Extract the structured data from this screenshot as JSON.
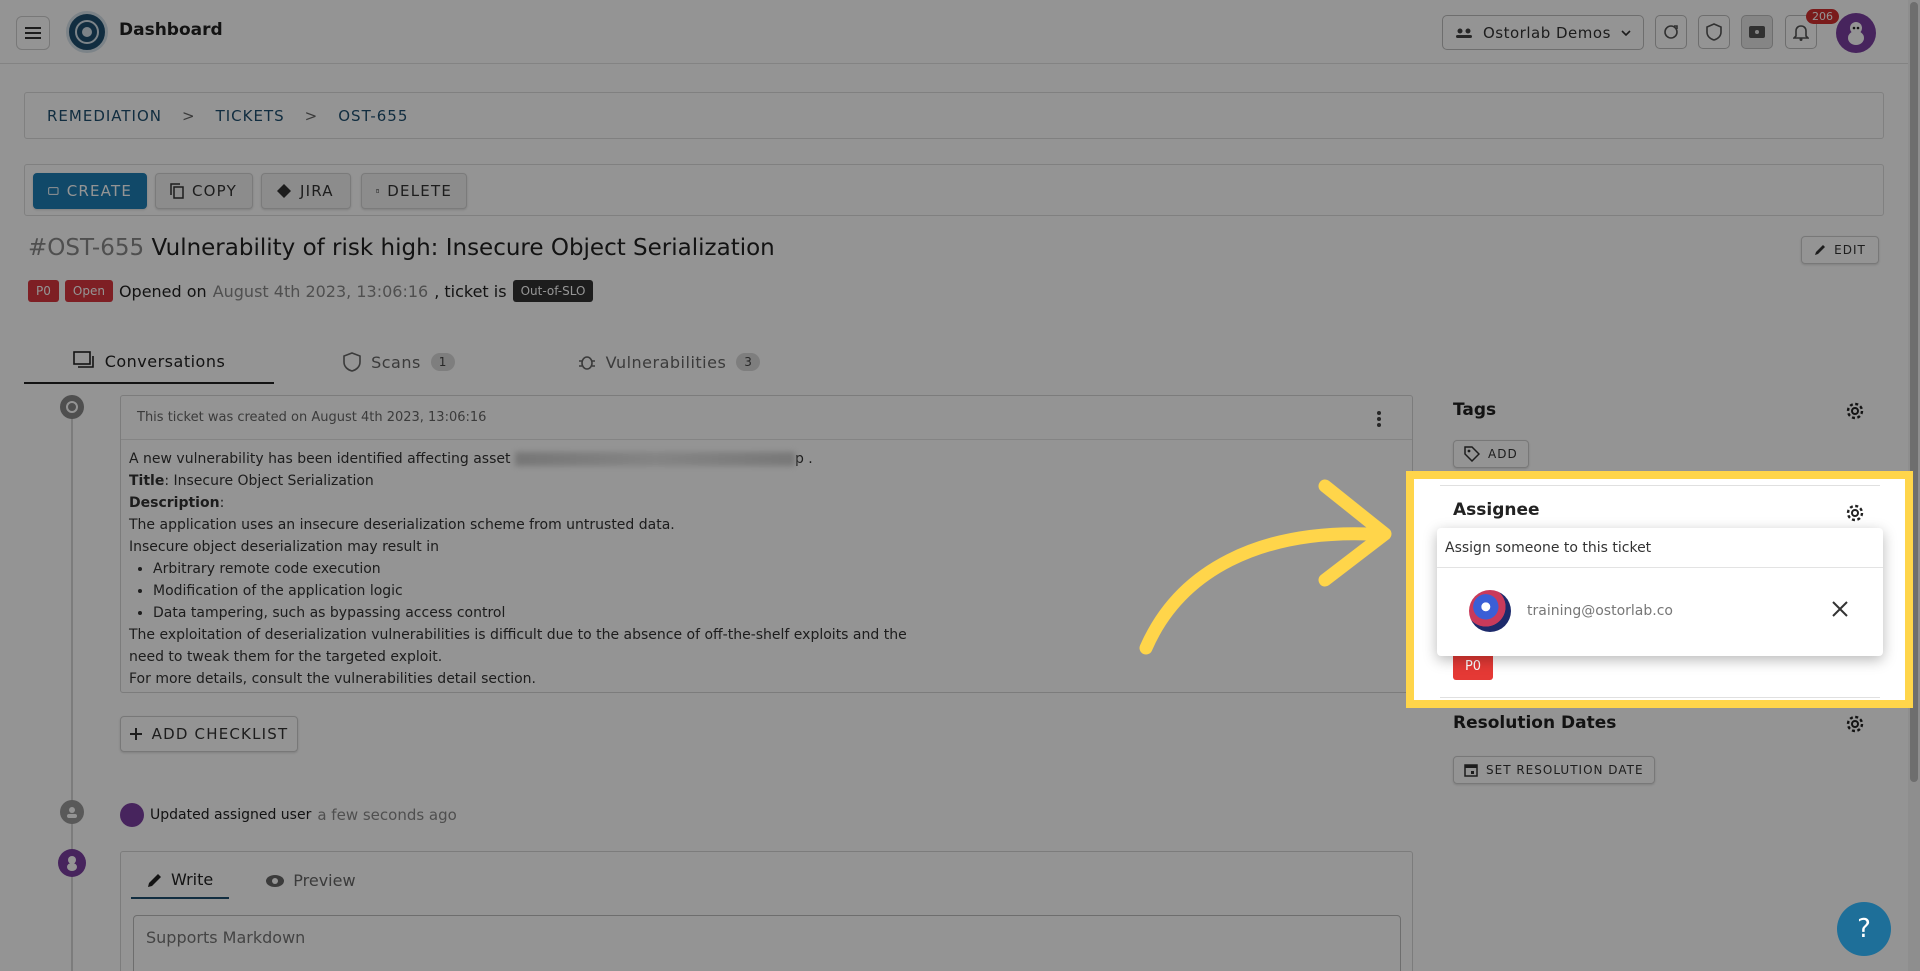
{
  "header": {
    "title": "Dashboard",
    "org": "Ostorlab Demos",
    "notification_count": "206"
  },
  "breadcrumb": [
    "REMEDIATION",
    "TICKETS",
    "OST-655"
  ],
  "breadcrumb_sep": ">",
  "actions": {
    "create": "CREATE",
    "copy": "COPY",
    "jira": "JIRA",
    "delete": "DELETE",
    "edit": "EDIT"
  },
  "ticket": {
    "id": "#OST-655",
    "title": "Vulnerability of risk high: Insecure Object Serialization",
    "priority": "P0",
    "status": "Open",
    "opened_label": "Opened on",
    "opened_at": "August 4th 2023, 13:06:16",
    "ticket_is": ", ticket is",
    "slo": "Out-of-SLO"
  },
  "tabs": {
    "conversations": "Conversations",
    "scans": "Scans",
    "scans_count": "1",
    "vulnerabilities": "Vulnerabilities",
    "vulnerabilities_count": "3"
  },
  "conversation": {
    "created_note": "This ticket was created on August 4th 2023, 13:06:16",
    "intro": "A new vulnerability has been identified affecting asset",
    "intro_suffix": "p .",
    "title_label": "Title",
    "title_value": ": Insecure Object Serialization",
    "description_label": "Description",
    "line1": "The application uses an insecure deserialization scheme from untrusted data.",
    "line2": "Insecure object deserialization may result in",
    "bullets": [
      "Arbitrary remote code execution",
      "Modification of the application logic",
      "Data tampering, such as bypassing access control"
    ],
    "line3": "The exploitation of deserialization vulnerabilities is difficult due to the absence of off-the-shelf exploits and the",
    "line4": "need to tweak them for the targeted exploit.",
    "line5": "For more details, consult the vulnerabilities detail section."
  },
  "add_checklist": "ADD CHECKLIST",
  "activity": {
    "text": "Updated assigned user",
    "time": "a few seconds ago"
  },
  "editor": {
    "write": "Write",
    "preview": "Preview",
    "placeholder": "Supports Markdown"
  },
  "sidebar": {
    "tags_title": "Tags",
    "tags_add": "ADD",
    "assignee_title": "Assignee",
    "assign_prompt": "Assign someone to this ticket",
    "assignee_email": "training@ostorlab.co",
    "priority_value": "P0",
    "resolution_title": "Resolution Dates",
    "set_resolution": "SET RESOLUTION DATE"
  },
  "help": "?",
  "colors": {
    "highlight": "#ffd54a",
    "primary": "#1e7fb5",
    "danger": "#d9363e"
  }
}
